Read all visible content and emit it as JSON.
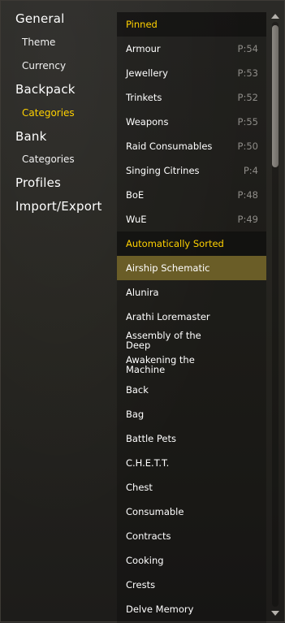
{
  "nav": {
    "general": "General",
    "theme": "Theme",
    "currency": "Currency",
    "backpack": "Backpack",
    "backpack_categories": "Categories",
    "bank": "Bank",
    "bank_categories": "Categories",
    "profiles": "Profiles",
    "import_export": "Import/Export"
  },
  "list": {
    "pinned_header": "Pinned",
    "pinned": [
      {
        "label": "Armour",
        "priority": "P:54"
      },
      {
        "label": "Jewellery",
        "priority": "P:53"
      },
      {
        "label": "Trinkets",
        "priority": "P:52"
      },
      {
        "label": "Weapons",
        "priority": "P:55"
      },
      {
        "label": "Raid Consumables",
        "priority": "P:50"
      },
      {
        "label": "Singing Citrines",
        "priority": "P:4"
      },
      {
        "label": "BoE",
        "priority": "P:48"
      },
      {
        "label": "WuE",
        "priority": "P:49"
      }
    ],
    "auto_header": "Automatically Sorted",
    "auto": [
      {
        "label": "Airship Schematic"
      },
      {
        "label": "Alunira"
      },
      {
        "label": "Arathi Loremaster"
      },
      {
        "label": "Assembly of the Deep"
      },
      {
        "label": "Awakening the Machine"
      },
      {
        "label": "Back"
      },
      {
        "label": "Bag"
      },
      {
        "label": "Battle Pets"
      },
      {
        "label": "C.H.E.T.T."
      },
      {
        "label": "Chest"
      },
      {
        "label": "Consumable"
      },
      {
        "label": "Contracts"
      },
      {
        "label": "Cooking"
      },
      {
        "label": "Crests"
      },
      {
        "label": "Delve Memory"
      }
    ]
  },
  "colors": {
    "accent": "#ffd100",
    "selected_row": "#6a5d27",
    "priority_text": "#8e8c88"
  }
}
